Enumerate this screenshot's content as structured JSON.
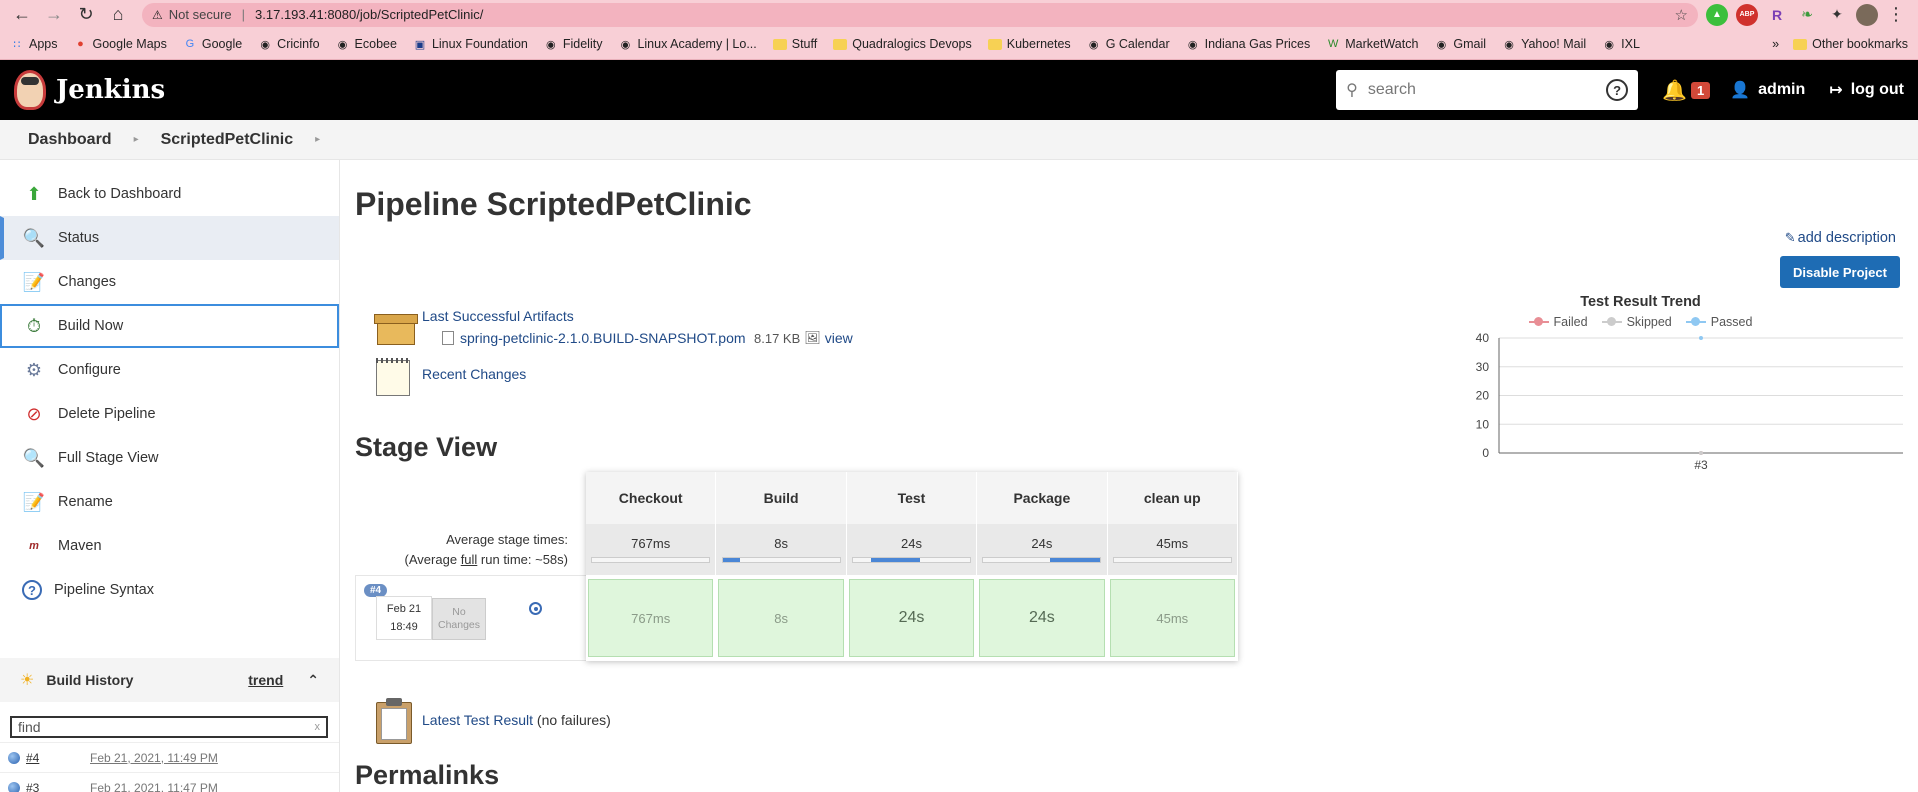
{
  "browser": {
    "not_secure": "Not secure",
    "url": "3.17.193.41:8080/job/ScriptedPetClinic/",
    "bookmarks": [
      {
        "label": "Apps",
        "icon": "apps-grid-icon"
      },
      {
        "label": "Google Maps",
        "icon": "maps-pin-icon"
      },
      {
        "label": "Google",
        "icon": "google-icon"
      },
      {
        "label": "Cricinfo",
        "icon": "globe-icon"
      },
      {
        "label": "Ecobee",
        "icon": "globe-icon"
      },
      {
        "label": "Linux Foundation",
        "icon": "linux-foundation-icon"
      },
      {
        "label": "Fidelity",
        "icon": "globe-icon"
      },
      {
        "label": "Linux Academy | Lo...",
        "icon": "globe-icon"
      },
      {
        "label": "Stuff",
        "icon": "folder-icon"
      },
      {
        "label": "Quadralogics Devops",
        "icon": "folder-icon"
      },
      {
        "label": "Kubernetes",
        "icon": "folder-icon"
      },
      {
        "label": "G Calendar",
        "icon": "globe-icon"
      },
      {
        "label": "Indiana Gas Prices",
        "icon": "globe-icon"
      },
      {
        "label": "MarketWatch",
        "icon": "marketwatch-icon"
      },
      {
        "label": "Gmail",
        "icon": "globe-icon"
      },
      {
        "label": "Yahoo! Mail",
        "icon": "globe-icon"
      },
      {
        "label": "IXL",
        "icon": "globe-icon"
      }
    ],
    "more_bookmarks": "»",
    "other_bookmarks": "Other bookmarks"
  },
  "header": {
    "app_name": "Jenkins",
    "search_placeholder": "search",
    "help": "?",
    "notification_count": "1",
    "user": "admin",
    "logout": "log out"
  },
  "breadcrumb": [
    "Dashboard",
    "ScriptedPetClinic"
  ],
  "sidebar": {
    "tasks": [
      {
        "label": "Back to Dashboard",
        "icon": "up-arrow-icon"
      },
      {
        "label": "Status",
        "icon": "magnifier-icon"
      },
      {
        "label": "Changes",
        "icon": "notepad-icon"
      },
      {
        "label": "Build Now",
        "icon": "clock-build-icon"
      },
      {
        "label": "Configure",
        "icon": "gear-icon"
      },
      {
        "label": "Delete Pipeline",
        "icon": "no-entry-icon"
      },
      {
        "label": "Full Stage View",
        "icon": "magnifier-icon"
      },
      {
        "label": "Rename",
        "icon": "notepad-icon"
      },
      {
        "label": "Maven",
        "icon": "maven-icon"
      },
      {
        "label": "Pipeline Syntax",
        "icon": "help-icon"
      }
    ],
    "build_history": {
      "title": "Build History",
      "trend": "trend",
      "find_placeholder": "find",
      "clear": "x",
      "builds": [
        {
          "num": "#4",
          "date": "Feb 21, 2021, 11:49 PM"
        },
        {
          "num": "#3",
          "date": "Feb 21, 2021, 11:47 PM"
        }
      ]
    }
  },
  "main": {
    "title": "Pipeline ScriptedPetClinic",
    "add_description": "add description",
    "disable_button": "Disable Project",
    "artifacts": {
      "label": "Last Successful Artifacts",
      "file": "spring-petclinic-2.1.0.BUILD-SNAPSHOT.pom",
      "size": "8.17 KB",
      "view": "view"
    },
    "recent_changes": "Recent Changes",
    "stage_view_title": "Stage View",
    "stage_view": {
      "avg_label_1": "Average stage times:",
      "avg_label_2_prefix": "(Average ",
      "avg_label_2_link": "full",
      "avg_label_2_suffix": " run time: ~58s)",
      "stages": [
        {
          "name": "Checkout",
          "avg": "767ms",
          "bar_start": 0.0,
          "bar_fill": 0.0
        },
        {
          "name": "Build",
          "avg": "8s",
          "bar_start": 0.0,
          "bar_fill": 0.15
        },
        {
          "name": "Test",
          "avg": "24s",
          "bar_start": 0.15,
          "bar_fill": 0.42
        },
        {
          "name": "Package",
          "avg": "24s",
          "bar_start": 0.57,
          "bar_fill": 0.43
        },
        {
          "name": "clean up",
          "avg": "45ms",
          "bar_start": 0.0,
          "bar_fill": 0.0
        }
      ],
      "build": {
        "num": "#4",
        "date": "Feb 21",
        "time": "18:49",
        "no_changes": "No Changes",
        "times": [
          "767ms",
          "8s",
          "24s",
          "24s",
          "45ms"
        ]
      }
    },
    "latest_test": {
      "link": "Latest Test Result",
      "note": "(no failures)"
    },
    "permalinks_title": "Permalinks"
  },
  "colors": {
    "failed": "#e88e95",
    "skipped": "#cccccc",
    "passed": "#8fc8f2",
    "stage_success": "#dff6dc",
    "jenkins_blue": "#1e6cb4"
  },
  "chart_data": {
    "type": "line",
    "title": "Test Result Trend",
    "categories": [
      "#3"
    ],
    "series": [
      {
        "name": "Failed",
        "values": [
          0
        ]
      },
      {
        "name": "Skipped",
        "values": [
          0
        ]
      },
      {
        "name": "Passed",
        "values": [
          40
        ]
      }
    ],
    "ylim": [
      0,
      40
    ],
    "yticks": [
      0,
      10,
      20,
      30,
      40
    ],
    "legend": "top",
    "grid": true
  }
}
